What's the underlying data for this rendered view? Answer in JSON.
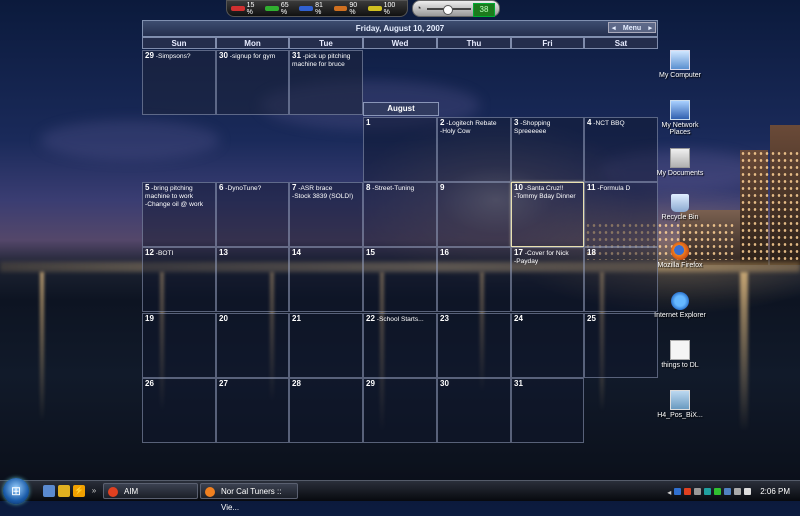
{
  "gadget": {
    "meters": [
      {
        "label": "15 %",
        "color": "#d03030"
      },
      {
        "label": "65 %",
        "color": "#30b030"
      },
      {
        "label": "81 %",
        "color": "#3060d0"
      },
      {
        "label": "90 %",
        "color": "#d07020"
      },
      {
        "label": "100 %",
        "color": "#d0c020"
      }
    ],
    "volume": "38"
  },
  "calendar": {
    "header": "Friday, August 10, 2007",
    "menu_label": "Menu",
    "days": [
      "Sun",
      "Mon",
      "Tue",
      "Wed",
      "Thu",
      "Fri",
      "Sat"
    ],
    "month_label": "August",
    "prev_month": [
      {
        "num": "29",
        "text": "-Simpsons?"
      },
      {
        "num": "30",
        "text": "-signup for gym"
      },
      {
        "num": "31",
        "text": "-pick up pitching machine for bruce"
      }
    ],
    "weeks": [
      [
        null,
        null,
        null,
        {
          "num": "1",
          "text": ""
        },
        {
          "num": "2",
          "text": "-Logitech Rebate\n-Holy Cow"
        },
        {
          "num": "3",
          "text": "-Shopping Spreeeeee"
        },
        {
          "num": "4",
          "text": "-NCT BBQ"
        }
      ],
      [
        {
          "num": "5",
          "text": "-bring pitching machine to work\n-Change oil @ work"
        },
        {
          "num": "6",
          "text": "-DynoTune?"
        },
        {
          "num": "7",
          "text": "-ASR brace\n-Stock 3839 (SOLD!)"
        },
        {
          "num": "8",
          "text": "-Street-Tuning"
        },
        {
          "num": "9",
          "text": ""
        },
        {
          "num": "10",
          "text": "-Santa Cruz!!\n-Tommy Bday Dinner"
        },
        {
          "num": "11",
          "text": "-Formula D"
        }
      ],
      [
        {
          "num": "12",
          "text": "-BOTI"
        },
        {
          "num": "13",
          "text": ""
        },
        {
          "num": "14",
          "text": ""
        },
        {
          "num": "15",
          "text": ""
        },
        {
          "num": "16",
          "text": ""
        },
        {
          "num": "17",
          "text": "-Cover for Nick\n-Payday"
        },
        {
          "num": "18",
          "text": ""
        }
      ],
      [
        {
          "num": "19",
          "text": ""
        },
        {
          "num": "20",
          "text": ""
        },
        {
          "num": "21",
          "text": ""
        },
        {
          "num": "22",
          "text": "-School Starts..."
        },
        {
          "num": "23",
          "text": ""
        },
        {
          "num": "24",
          "text": ""
        },
        {
          "num": "25",
          "text": ""
        }
      ],
      [
        {
          "num": "26",
          "text": ""
        },
        {
          "num": "27",
          "text": ""
        },
        {
          "num": "28",
          "text": ""
        },
        {
          "num": "29",
          "text": ""
        },
        {
          "num": "30",
          "text": ""
        },
        {
          "num": "31",
          "text": ""
        },
        null
      ]
    ],
    "highlight_day": "10"
  },
  "desktop_icons": [
    {
      "label": "My Computer",
      "icon": "computer-icon"
    },
    {
      "label": "My Network Places",
      "icon": "network-icon"
    },
    {
      "label": "My Documents",
      "icon": "documents-icon"
    },
    {
      "label": "Recycle Bin",
      "icon": "recycle-bin-icon"
    },
    {
      "label": "Mozilla Firefox",
      "icon": "firefox-icon"
    },
    {
      "label": "Internet Explorer",
      "icon": "ie-icon"
    },
    {
      "label": "things to DL",
      "icon": "text-file-icon"
    },
    {
      "label": "H4_Pos_BiX...",
      "icon": "image-file-icon"
    }
  ],
  "taskbar": {
    "tasks": [
      {
        "label": "AIM",
        "icon_color": "#e04020"
      },
      {
        "label": "Nor Cal Tuners :: Vie...",
        "icon_color": "#f08020"
      }
    ],
    "clock": "2:06 PM"
  }
}
